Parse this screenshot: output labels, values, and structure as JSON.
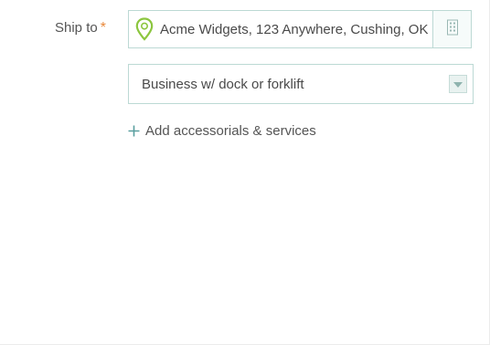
{
  "ship_to": {
    "label": "Ship to",
    "required_mark": "*",
    "address_value": "Acme Widgets, 123 Anywhere, Cushing, OK",
    "icons": {
      "location": "map-pin-icon",
      "address_book": "building-icon"
    }
  },
  "location_type": {
    "selected": "Business w/ dock or forklift",
    "dropdown_icon": "chevron-down-icon"
  },
  "accessorials": {
    "link_label": "Add accessorials & services",
    "icon": "plus-icon"
  },
  "colors": {
    "required": "#e8883a",
    "pin": "#8cc63f",
    "border": "#bcd9d4",
    "accent": "#5a9fa0"
  }
}
